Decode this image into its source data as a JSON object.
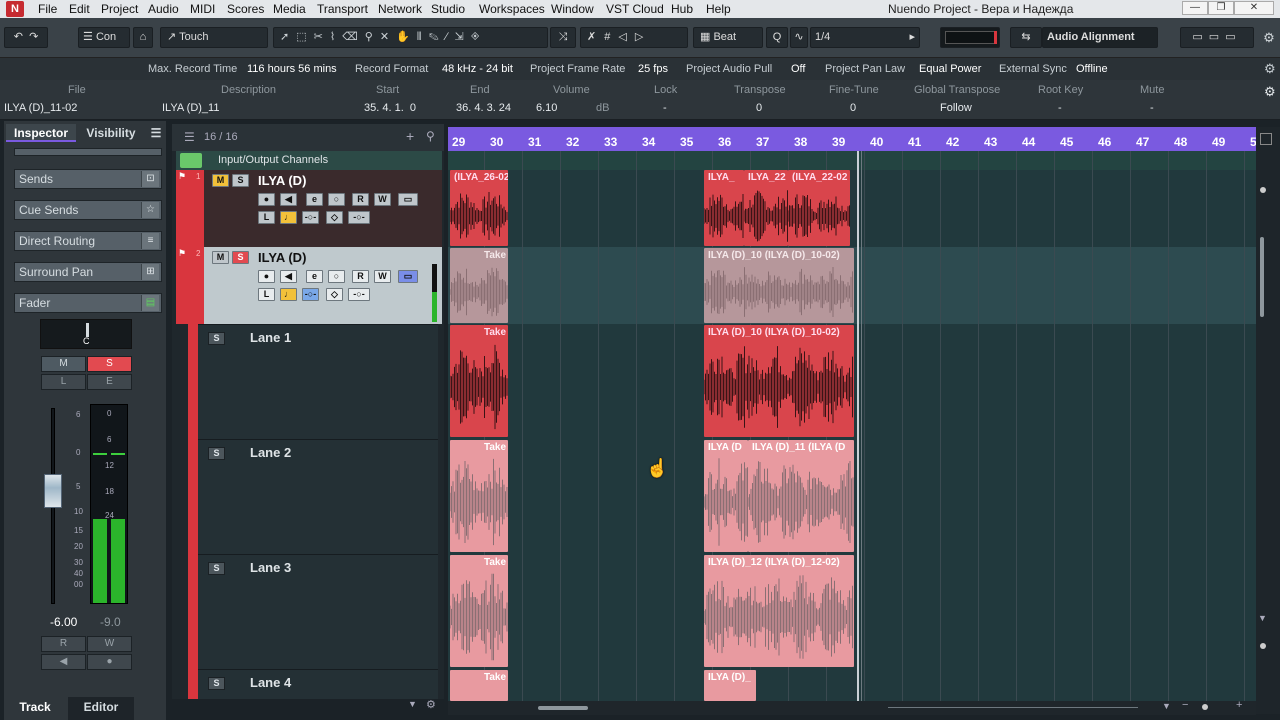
{
  "menubar": {
    "items": [
      "File",
      "Edit",
      "Project",
      "Audio",
      "MIDI",
      "Scores",
      "Media",
      "Transport",
      "Network",
      "Studio",
      "Workspaces",
      "Window",
      "VST Cloud",
      "Hub",
      "Help"
    ],
    "title": "Nuendo Project - Вера и Надежда"
  },
  "toolbar": {
    "automation_mode": "Touch",
    "constrain": "Con",
    "snap_type": "Beat",
    "quantize": "1/4",
    "audio_alignment": "Audio Alignment"
  },
  "infoline": {
    "max_record_label": "Max. Record Time",
    "max_record_value": "116 hours 56 mins",
    "record_format_label": "Record Format",
    "record_format_value": "48 kHz - 24 bit",
    "frame_rate_label": "Project Frame Rate",
    "frame_rate_value": "25 fps",
    "audio_pull_label": "Project Audio Pull",
    "audio_pull_value": "Off",
    "pan_law_label": "Project Pan Law",
    "pan_law_value": "Equal Power",
    "ext_sync_label": "External Sync",
    "ext_sync_value": "Offline"
  },
  "eventinfo": {
    "headers": [
      "File",
      "Description",
      "Start",
      "End",
      "Volume",
      "Lock",
      "Transpose",
      "Fine-Tune",
      "Global Transpose",
      "Root Key",
      "Mute"
    ],
    "file": "ILYA (D)_11-02",
    "description": "ILYA (D)_11",
    "start": "35. 4. 1.  0",
    "end": "36. 4. 3. 24",
    "volume": "6.10",
    "volume_unit": "dB",
    "lock": "-",
    "transpose": "0",
    "finetune": "0",
    "global_transpose": "Follow",
    "root_key": "-",
    "mute": "-"
  },
  "inspector": {
    "tab_inspector": "Inspector",
    "tab_visibility": "Visibility",
    "sections": [
      "Sends",
      "Cue Sends",
      "Direct Routing",
      "Surround Pan",
      "Fader"
    ],
    "pan": "C",
    "m": "M",
    "s": "S",
    "l": "L",
    "e": "E",
    "r": "R",
    "w": "W",
    "volume": "-6.00",
    "peak": "-9.0",
    "fader_scale": [
      "6",
      "0",
      "5",
      "10",
      "15",
      "20",
      "30",
      "40",
      "00"
    ],
    "meter_scale": [
      "0",
      "6",
      "12",
      "18",
      "24"
    ]
  },
  "bottomtabs": {
    "track": "Track",
    "editor": "Editor"
  },
  "tracklist": {
    "count": "16 / 16",
    "folder": "Input/Output Channels",
    "tracks": [
      {
        "num": "1",
        "name": "ILYA (D)"
      },
      {
        "num": "2",
        "name": "ILYA (D)"
      }
    ],
    "lanes": [
      "Lane 1",
      "Lane 2",
      "Lane 3",
      "Lane 4"
    ],
    "btn_m": "M",
    "btn_s": "S",
    "btn_r": "R",
    "btn_w": "W",
    "btn_l": "L",
    "btn_e": "e"
  },
  "ruler": {
    "bars": [
      "29",
      "30",
      "31",
      "32",
      "33",
      "34",
      "35",
      "36",
      "37",
      "38",
      "39",
      "40",
      "41",
      "42",
      "43",
      "44",
      "45",
      "46",
      "47",
      "48",
      "49",
      "50"
    ]
  },
  "events": {
    "t1_a": "(ILYA_26-02",
    "t1_b": "ILYA_",
    "t1_c": "ILYA_22",
    "t1_d": "(ILYA_22-02",
    "t2_a": "Take",
    "t2_b": "ILYA (D)_10 (ILYA (D)_10-02)",
    "l1_a": "Take",
    "l1_b": "ILYA (D)_10 (ILYA (D)_10-02)",
    "l2_a": "Take",
    "l2_b": "ILYA (D",
    "l2_c": "ILYA (D)_11 (ILYA (D",
    "l3_a": "Take",
    "l3_b": "ILYA (D)_12 (ILYA (D)_12-02)",
    "l4_a": "Take",
    "l4_b": "ILYA (D)_"
  },
  "colors": {
    "accent": "#7a5ae0",
    "track": "#d9363e",
    "event_selected": "#d9454c",
    "event_lane": "#e89aa0"
  }
}
